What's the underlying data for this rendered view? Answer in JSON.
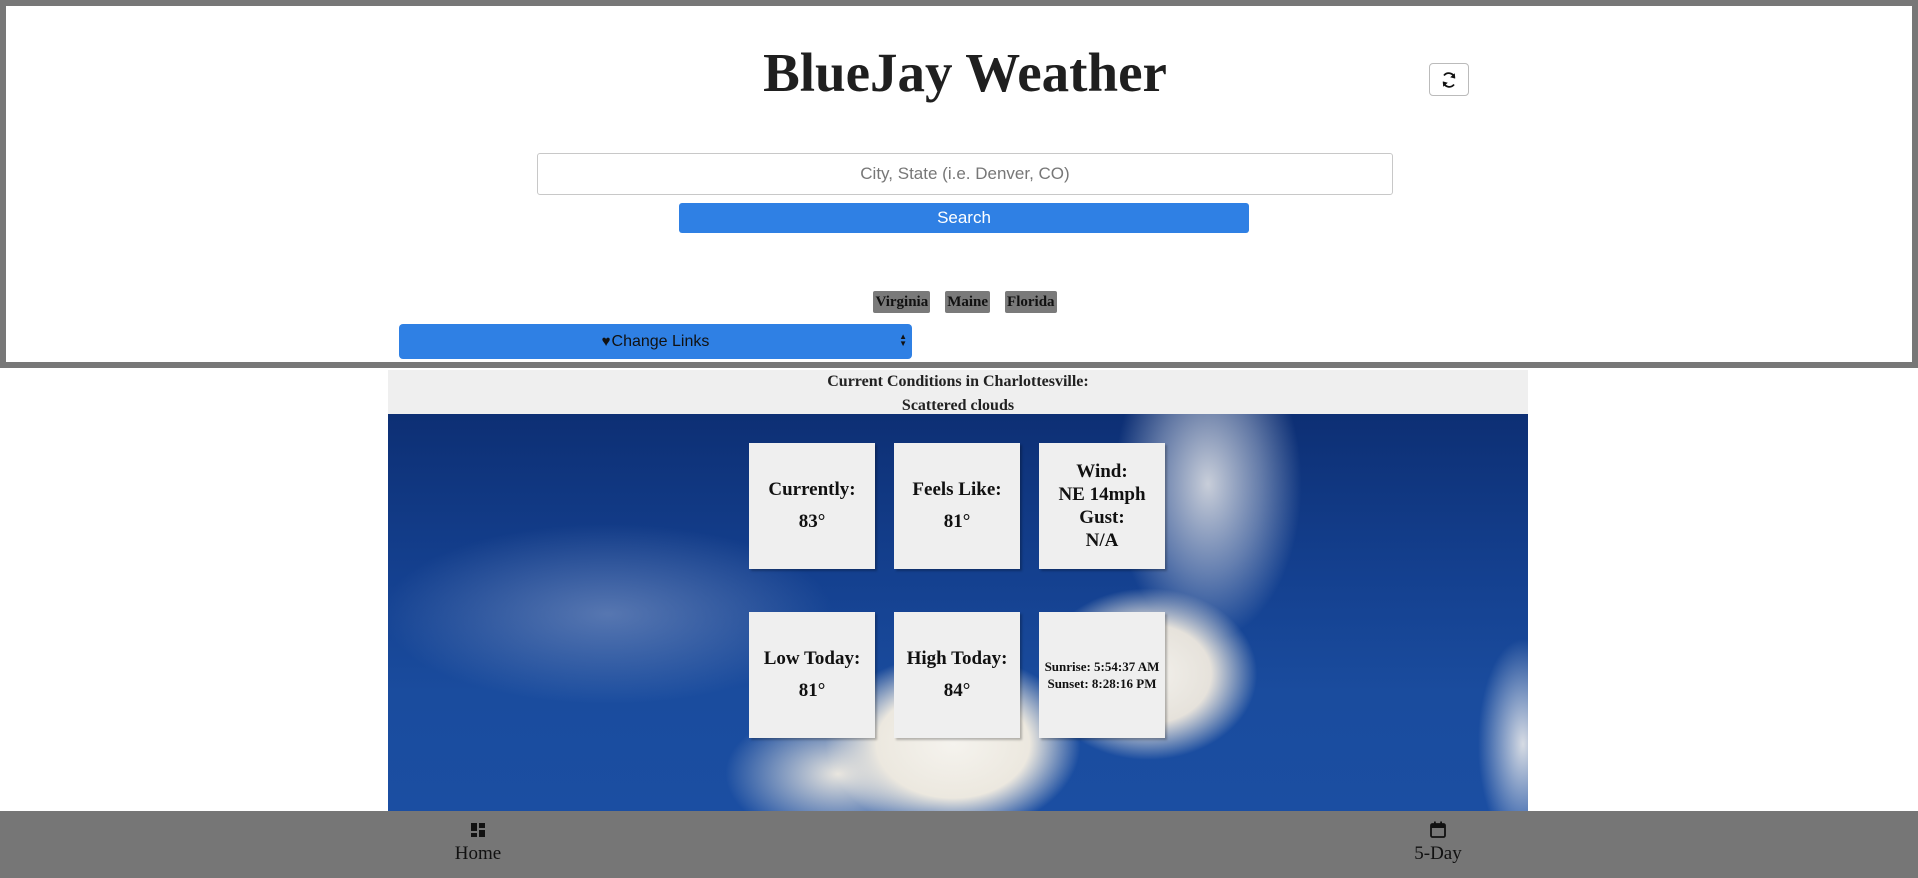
{
  "header": {
    "title": "BlueJay Weather",
    "refresh_icon": "refresh-icon"
  },
  "search": {
    "placeholder": "City, State (i.e. Denver, CO)",
    "value": "",
    "button_label": "Search"
  },
  "quick_links": [
    "Virginia",
    "Maine",
    "Florida"
  ],
  "change_links": {
    "label": "Change Links",
    "icon": "heart-icon"
  },
  "conditions": {
    "heading": "Current Conditions in Charlottesville:",
    "description": "Scattered clouds",
    "cards": {
      "currently": {
        "label": "Currently:",
        "value": "83°"
      },
      "feels_like": {
        "label": "Feels Like:",
        "value": "81°"
      },
      "wind": {
        "label": "Wind:",
        "value": "NE 14mph",
        "gust_label": "Gust:",
        "gust_value": "N/A"
      },
      "low": {
        "label": "Low Today:",
        "value": "81°"
      },
      "high": {
        "label": "High Today:",
        "value": "84°"
      },
      "sun": {
        "sunrise": "Sunrise: 5:54:37 AM",
        "sunset": "Sunset: 8:28:16 PM"
      }
    }
  },
  "nav": {
    "home": {
      "label": "Home",
      "icon": "dashboard-icon"
    },
    "five_day": {
      "label": "5-Day",
      "icon": "calendar-icon"
    }
  },
  "colors": {
    "accent": "#2f80e4",
    "frame": "#777777",
    "nav_bg": "#767676",
    "card_bg": "#efefef"
  }
}
